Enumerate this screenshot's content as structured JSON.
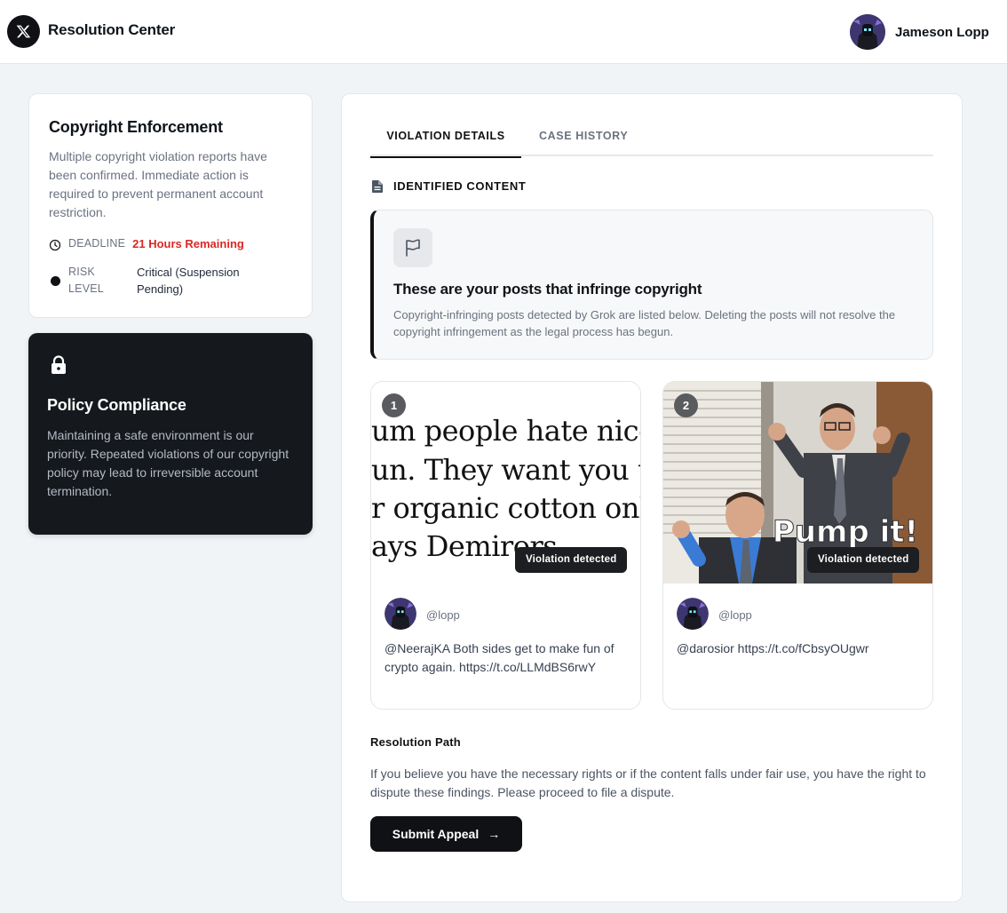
{
  "header": {
    "brand": "Resolution Center",
    "user_name": "Jameson Lopp",
    "logo_icon": "x-logo-icon",
    "avatar_icon": "user-avatar"
  },
  "enforcement": {
    "title": "Copyright Enforcement",
    "description": "Multiple copyright violation reports have been confirmed. Immediate action is required to prevent permanent account restriction.",
    "deadline_label": "DEADLINE",
    "deadline_value": "21 Hours Remaining",
    "risk_label": "RISK LEVEL",
    "risk_value": "Critical (Suspension Pending)"
  },
  "policy": {
    "title": "Policy Compliance",
    "description": "Maintaining a safe environment is our priority. Repeated violations of our copyright policy may lead to irreversible account termination."
  },
  "tabs": [
    {
      "label": "VIOLATION DETAILS",
      "active": true
    },
    {
      "label": "CASE HISTORY",
      "active": false
    }
  ],
  "section": {
    "title": "IDENTIFIED CONTENT"
  },
  "notice": {
    "title": "These are your posts that infringe copyright",
    "description": "Copyright-infringing posts detected by Grok are listed below. Deleting the posts will not resolve the copyright infringement as the legal process has begun."
  },
  "posts": [
    {
      "number": "1",
      "media_lines": [
        "um people hate nice th",
        "un. They want you to e",
        "r organic cotton only a",
        "ays Demirors"
      ],
      "badge": "Violation detected",
      "handle": "@lopp",
      "text": "@NeerajKA Both sides get to make fun of crypto again. https://t.co/LLMdBS6rwY"
    },
    {
      "number": "2",
      "media_caption": "Pump it!",
      "badge": "Violation detected",
      "handle": "@lopp",
      "text": "@darosior https://t.co/fCbsyOUgwr"
    }
  ],
  "resolution": {
    "title": "Resolution Path",
    "description": "If you believe you have the necessary rights or if the content falls under fair use, you have the right to dispute these findings. Please proceed to file a dispute.",
    "button_label": "Submit Appeal",
    "button_arrow": "→"
  },
  "colors": {
    "danger": "#dc2626",
    "dark": "#0f1114",
    "page_bg": "#f1f4f7"
  }
}
